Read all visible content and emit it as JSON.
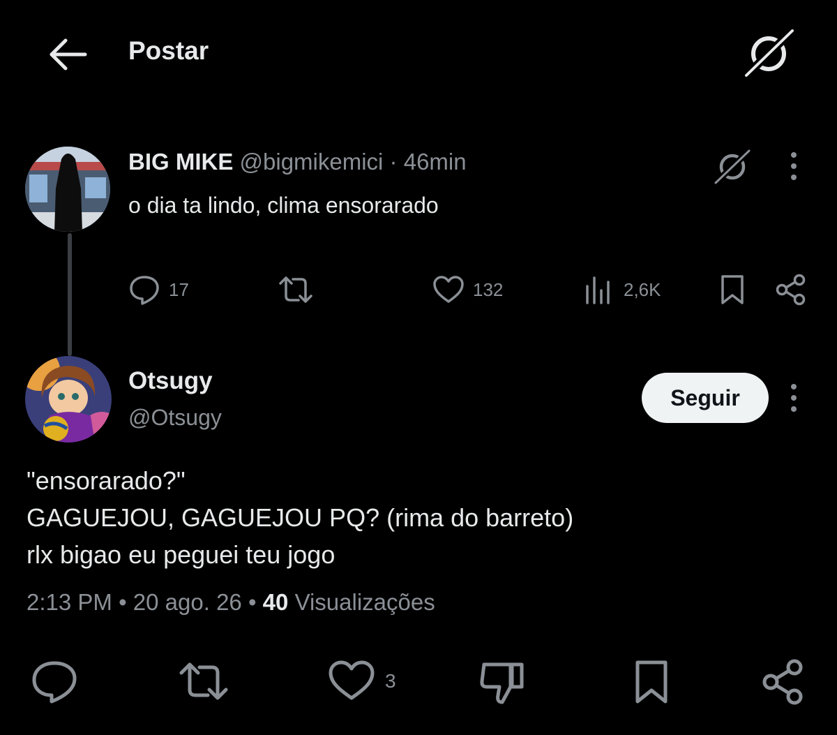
{
  "header": {
    "title": "Postar",
    "back_icon": "arrow-left-icon",
    "grok_icon": "grok-icon"
  },
  "parent_tweet": {
    "display_name": "BIG MIKE",
    "handle": "@bigmikemici",
    "separator": " · ",
    "time": "46min",
    "text": "o dia ta lindo, clima ensorarado",
    "replies": "17",
    "likes": "132",
    "views": "2,6K"
  },
  "main_tweet": {
    "display_name": "Otsugy",
    "handle": "@Otsugy",
    "follow_label": "Seguir",
    "text": "\"ensorarado?\"\nGAGUEJOU, GAGUEJOU PQ? (rima do barreto)\nrlx bigao eu peguei teu jogo",
    "time": "2:13 PM",
    "dot": " • ",
    "date": "20 ago. 26",
    "views_count": "40",
    "views_label": "Visualizações",
    "likes": "3"
  },
  "colors": {
    "background": "#000000",
    "text": "#e7e9ea",
    "muted": "#8b9096",
    "follow_bg": "#eff3f4",
    "thread_line": "#3b3f44"
  }
}
